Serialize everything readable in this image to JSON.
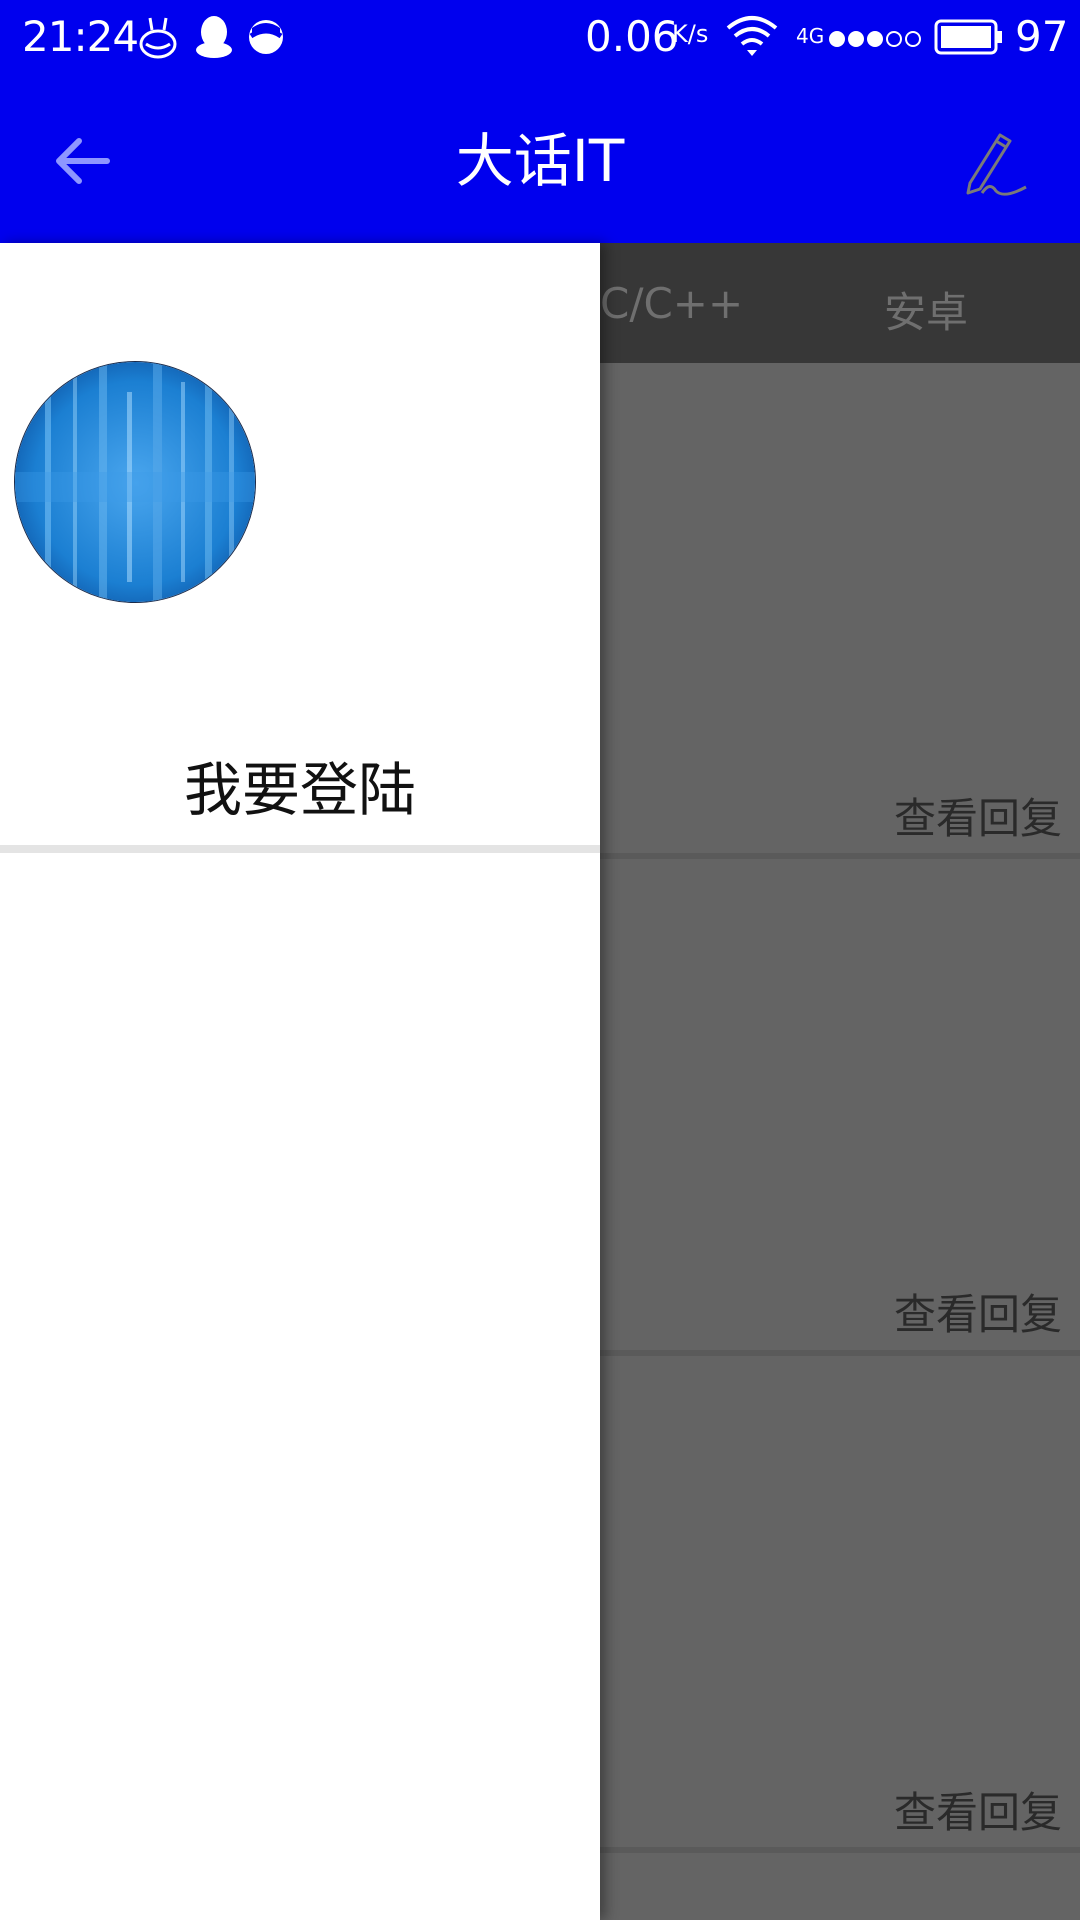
{
  "status_bar": {
    "time": "21:24",
    "net_speed": "0.06",
    "net_speed_unit": "K/s",
    "network_type": "4G",
    "battery_level": "97",
    "notification_icons": [
      "bunny-app-icon",
      "qq-icon",
      "half-circle-app-icon"
    ]
  },
  "app_bar": {
    "title": "大话IT",
    "back_icon": "arrow-back-icon",
    "edit_icon": "pen-icon",
    "background_color": "#0000ee"
  },
  "tabs": [
    {
      "label": "C/C++"
    },
    {
      "label": "安卓"
    }
  ],
  "posts": [
    {
      "action_label": "查看回复"
    },
    {
      "action_label": "查看回复"
    },
    {
      "action_label": "查看回复"
    }
  ],
  "drawer": {
    "avatar_icon": "avatar-image",
    "login_label": "我要登陆"
  }
}
